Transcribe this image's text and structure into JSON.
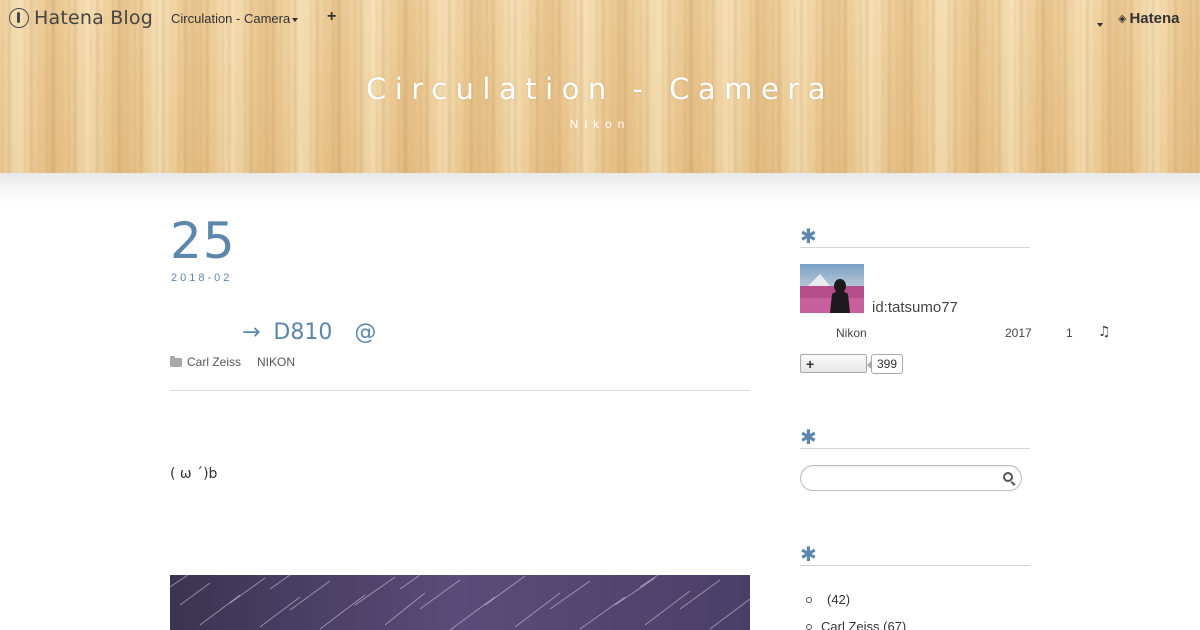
{
  "navbar": {
    "brand": "Hatena Blog",
    "blog_menu": "Circulation - Camera",
    "plus": "+",
    "right_brand": "Hatena"
  },
  "header": {
    "title": "Circulation - Camera",
    "description": "Nikon"
  },
  "entry": {
    "day": "25",
    "year_month": "2018-02",
    "title": "→ D810　@",
    "categories": [
      "Carl Zeiss",
      "NIKON"
    ],
    "text": "( ω ´)b"
  },
  "sidebar": {
    "profile": {
      "user_id": "id:tatsumo77",
      "line_left": "Nikon",
      "line_year": "2017",
      "line_count": "1",
      "music_icon": "♫",
      "follow_plus": "+",
      "follow_count": "399"
    },
    "search": {
      "placeholder": ""
    },
    "categories": [
      {
        "label": "(42)"
      },
      {
        "label": "Carl Zeiss (67)"
      }
    ]
  },
  "colors": {
    "accent": "#5b87ad",
    "header_wood": "#ebc994"
  }
}
